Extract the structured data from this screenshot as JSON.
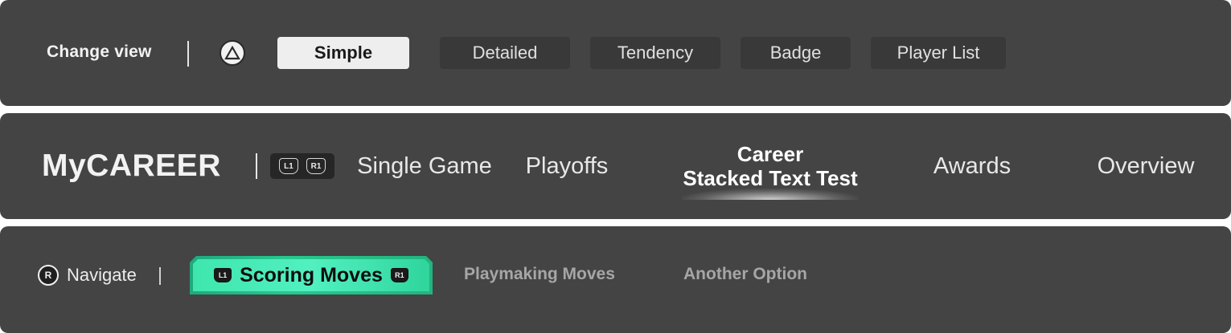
{
  "view_bar": {
    "label": "Change view",
    "button_icon": "triangle-button-icon",
    "options": [
      {
        "label": "Simple",
        "active": true
      },
      {
        "label": "Detailed",
        "active": false
      },
      {
        "label": "Tendency",
        "active": false
      },
      {
        "label": "Badge",
        "active": false
      },
      {
        "label": "Player List",
        "active": false
      }
    ]
  },
  "career_bar": {
    "brand": "MyCAREER",
    "left_bumper": "L1",
    "right_bumper": "R1",
    "tabs": [
      {
        "label": "Single Game"
      },
      {
        "label": "Playoffs"
      },
      {
        "label_line1": "Career",
        "label_line2": "Stacked Text Test",
        "active": true
      },
      {
        "label": "Awards"
      },
      {
        "label": "Overview"
      }
    ]
  },
  "moves_bar": {
    "nav_button": "R",
    "nav_label": "Navigate",
    "left_bumper": "L1",
    "right_bumper": "R1",
    "active_tab": "Scoring Moves",
    "tabs": [
      "Playmaking Moves",
      "Another Option"
    ],
    "accent_color": "#3ee6ad"
  }
}
